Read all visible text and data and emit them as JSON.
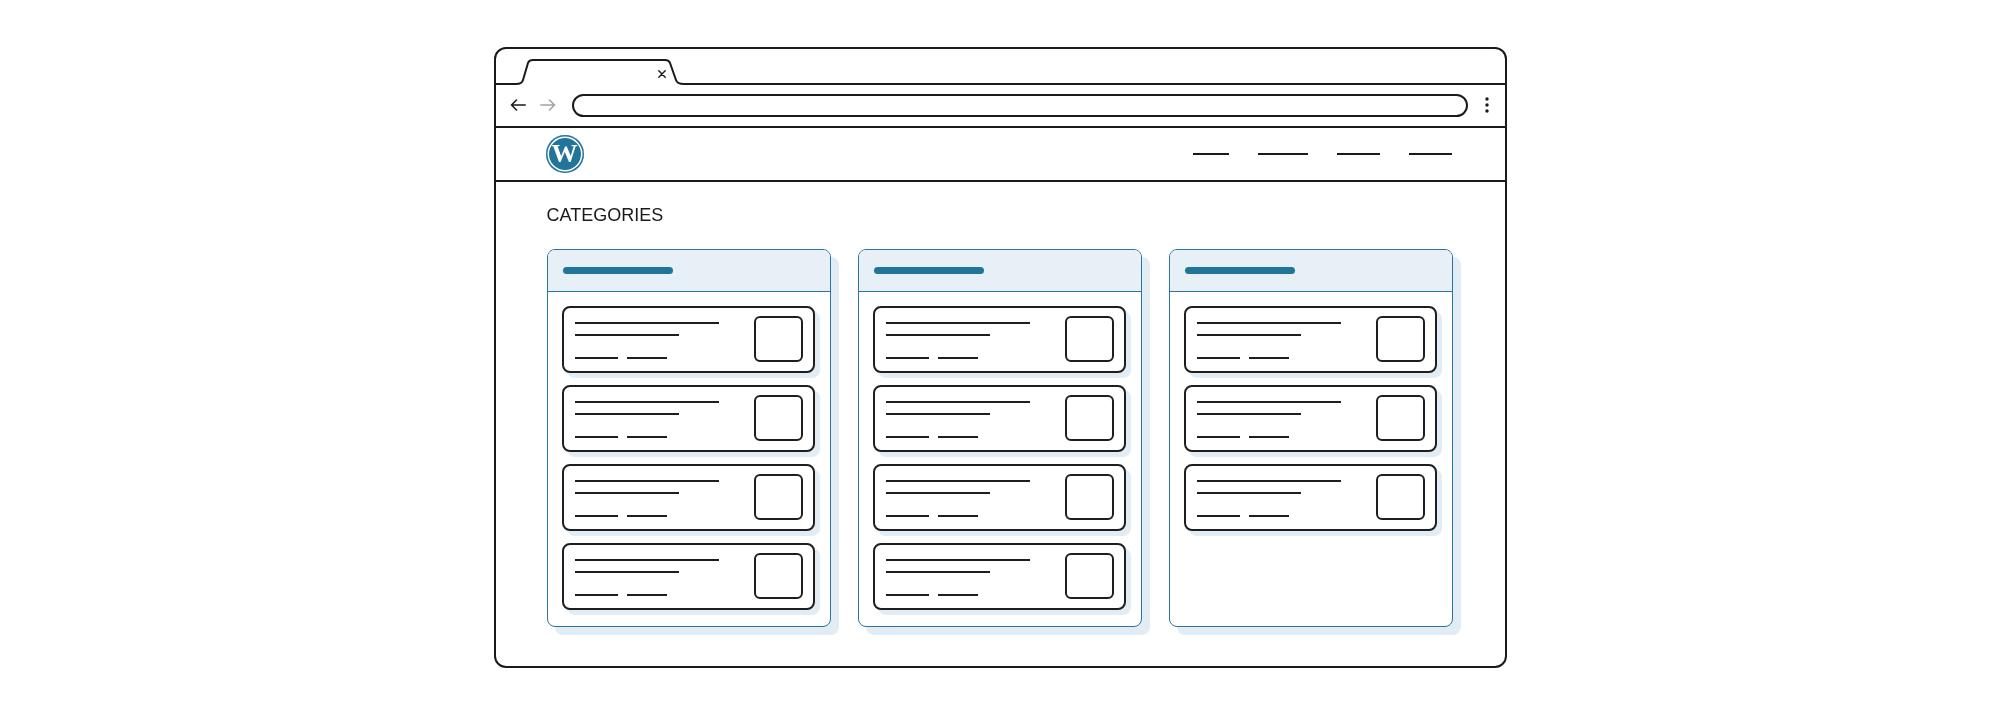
{
  "browser": {
    "tabs": [
      {
        "selected": true
      }
    ],
    "back_button": {
      "disabled": false
    },
    "forward_button": {
      "disabled": true
    }
  },
  "site_header": {
    "logo": "W",
    "nav_links": [
      {
        "kind": "short"
      },
      {
        "kind": "long"
      },
      {
        "kind": "medium"
      },
      {
        "kind": "medium"
      }
    ]
  },
  "page": {
    "heading": "CATEGORIES",
    "columns": [
      {
        "cards": [
          {
            "has_thumbnail": true
          },
          {
            "has_thumbnail": true
          },
          {
            "has_thumbnail": true
          },
          {
            "has_thumbnail": true
          }
        ]
      },
      {
        "cards": [
          {
            "has_thumbnail": true
          },
          {
            "has_thumbnail": true
          },
          {
            "has_thumbnail": true
          },
          {
            "has_thumbnail": true
          }
        ]
      },
      {
        "cards": [
          {
            "has_thumbnail": true
          },
          {
            "has_thumbnail": true
          },
          {
            "has_thumbnail": true
          }
        ]
      }
    ]
  }
}
